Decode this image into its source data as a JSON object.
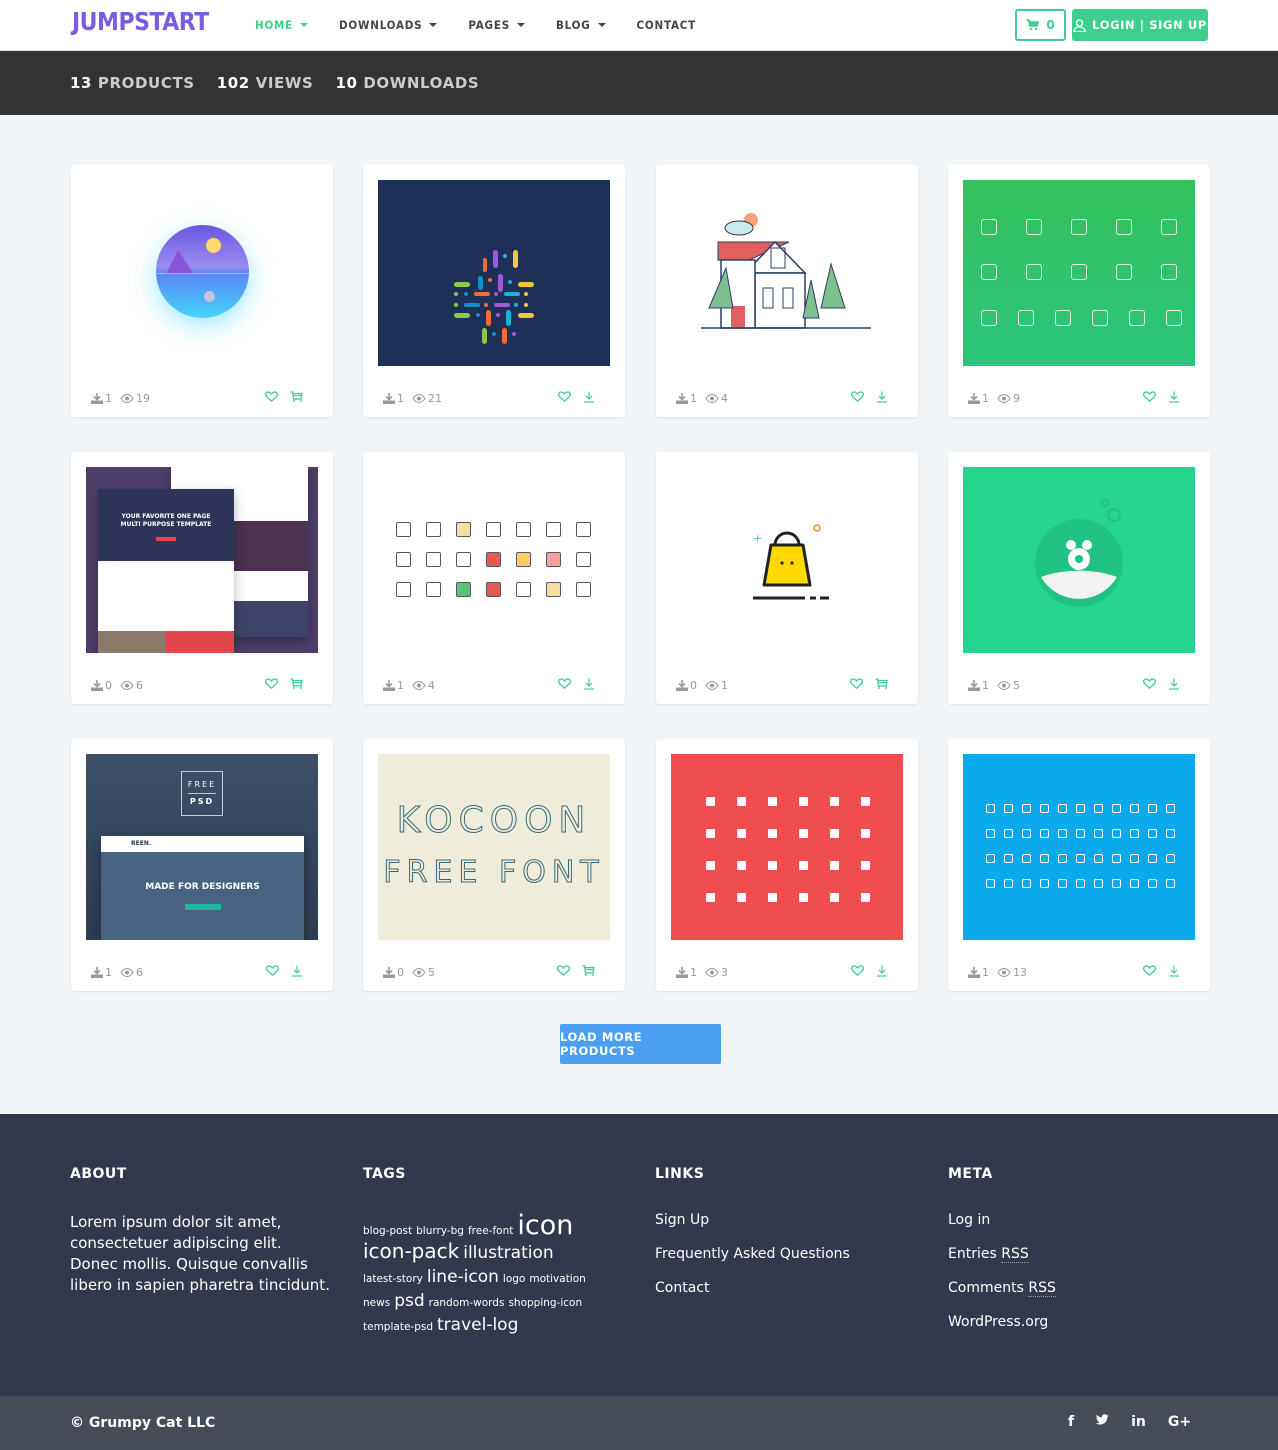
{
  "header": {
    "logo": "JUMPSTART",
    "nav": [
      {
        "label": "HOME",
        "dropdown": true,
        "active": true
      },
      {
        "label": "DOWNLOADS",
        "dropdown": true,
        "active": false
      },
      {
        "label": "PAGES",
        "dropdown": true,
        "active": false
      },
      {
        "label": "BLOG",
        "dropdown": true,
        "active": false
      },
      {
        "label": "CONTACT",
        "dropdown": false,
        "active": false
      }
    ],
    "cart_count": "0",
    "login_label": "LOGIN | SIGN UP",
    "accent_color": "#3ecf8e",
    "logo_color": "#7b5be0"
  },
  "stats": {
    "products": {
      "num": "13",
      "label": "PRODUCTS"
    },
    "views": {
      "num": "102",
      "label": "VIEWS"
    },
    "downloads": {
      "num": "10",
      "label": "DOWNLOADS"
    }
  },
  "products": [
    {
      "thumb": "moon-landscape-circle",
      "downloads": "1",
      "views": "19",
      "action": "cart"
    },
    {
      "thumb": "colorful-hashtag-pills",
      "downloads": "1",
      "views": "21",
      "action": "download"
    },
    {
      "thumb": "house-illustration",
      "downloads": "1",
      "views": "4",
      "action": "download"
    },
    {
      "thumb": "green-business-icons",
      "downloads": "1",
      "views": "9",
      "action": "download"
    },
    {
      "thumb": "one-page-template",
      "downloads": "0",
      "views": "6",
      "action": "cart",
      "text1": "YOUR FAVORITE ONE PAGE",
      "text2": "MULTI PURPOSE TEMPLATE"
    },
    {
      "thumb": "shopping-line-icons",
      "downloads": "1",
      "views": "4",
      "action": "download"
    },
    {
      "thumb": "shopping-bag-icon",
      "downloads": "0",
      "views": "1",
      "action": "cart"
    },
    {
      "thumb": "pufferfish",
      "downloads": "1",
      "views": "5",
      "action": "download"
    },
    {
      "thumb": "reen-free-psd",
      "downloads": "1",
      "views": "6",
      "action": "download",
      "text1": "FREE",
      "text2": "PSD",
      "text3": "MADE FOR DESIGNERS",
      "text4": "REEN."
    },
    {
      "thumb": "kocoon-font",
      "downloads": "0",
      "views": "5",
      "action": "cart",
      "text1": "KOCOON",
      "text2": "FREE FONT"
    },
    {
      "thumb": "red-icon-set",
      "downloads": "1",
      "views": "3",
      "action": "download"
    },
    {
      "thumb": "blue-icon-set",
      "downloads": "1",
      "views": "13",
      "action": "download"
    }
  ],
  "load_more_label": "LOAD MORE PRODUCTS",
  "footer": {
    "about": {
      "title": "ABOUT",
      "text": "Lorem ipsum dolor sit amet, consectetuer adipiscing elit. Donec mollis. Quisque convallis libero in sapien pharetra tincidunt."
    },
    "tags": {
      "title": "TAGS",
      "items": [
        {
          "label": "blog-post",
          "size": "s"
        },
        {
          "label": "blurry-bg",
          "size": "s"
        },
        {
          "label": "free-font",
          "size": "s"
        },
        {
          "label": "icon",
          "size": "xl"
        },
        {
          "label": "icon-pack",
          "size": "l"
        },
        {
          "label": "illustration",
          "size": "m"
        },
        {
          "label": "latest-story",
          "size": "s"
        },
        {
          "label": "line-icon",
          "size": "m"
        },
        {
          "label": "logo",
          "size": "s"
        },
        {
          "label": "motivation",
          "size": "s"
        },
        {
          "label": "news",
          "size": "s"
        },
        {
          "label": "psd",
          "size": "m"
        },
        {
          "label": "random-words",
          "size": "s"
        },
        {
          "label": "shopping-icon",
          "size": "s"
        },
        {
          "label": "template-psd",
          "size": "s"
        },
        {
          "label": "travel-log",
          "size": "m"
        }
      ]
    },
    "links": {
      "title": "LINKS",
      "items": [
        "Sign Up",
        "Frequently Asked Questions",
        "Contact"
      ]
    },
    "meta": {
      "title": "META",
      "items": [
        {
          "pre": "Log in",
          "abbr": ""
        },
        {
          "pre": "Entries ",
          "abbr": "RSS"
        },
        {
          "pre": "Comments ",
          "abbr": "RSS"
        },
        {
          "pre": "WordPress.org",
          "abbr": ""
        }
      ]
    }
  },
  "bottom": {
    "copyright": "© Grumpy Cat LLC",
    "social": [
      {
        "name": "facebook",
        "glyph": "f"
      },
      {
        "name": "twitter",
        "glyph": "t"
      },
      {
        "name": "linkedin",
        "glyph": "in"
      },
      {
        "name": "google-plus",
        "glyph": "G+"
      }
    ]
  }
}
